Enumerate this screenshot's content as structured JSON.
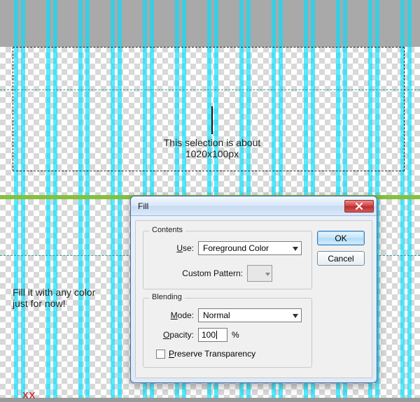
{
  "annotations": {
    "selection_info_line1": "This selection is about",
    "selection_info_line2": "1020x100px",
    "fill_hint_line1": "Fill it with any color",
    "fill_hint_line2": "just for now!",
    "footer_marker": "XX"
  },
  "dialog": {
    "title": "Fill",
    "buttons": {
      "ok": "OK",
      "cancel": "Cancel"
    },
    "contents": {
      "legend": "Contents",
      "use_label": "Use:",
      "use_value": "Foreground Color",
      "custom_pattern_label": "Custom Pattern:"
    },
    "blending": {
      "legend": "Blending",
      "mode_label": "Mode:",
      "mode_value": "Normal",
      "opacity_label": "Opacity:",
      "opacity_value": "100",
      "opacity_unit": "%",
      "preserve_label": "Preserve Transparency"
    }
  }
}
